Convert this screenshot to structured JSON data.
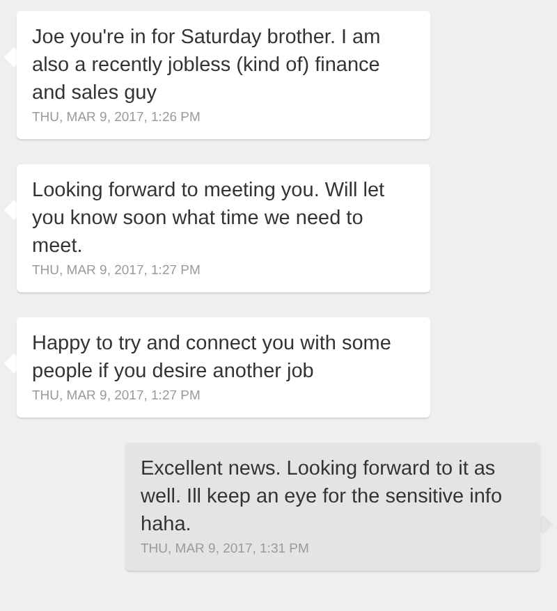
{
  "messages": [
    {
      "kind": "incoming",
      "text": "Joe you're in for Saturday brother. I am also a recently jobless (kind of) finance and sales guy",
      "time": "THU, MAR 9, 2017, 1:26 PM"
    },
    {
      "kind": "incoming",
      "text": "Looking forward to meeting you. Will let you know soon what time we need to meet.",
      "time": "THU, MAR 9, 2017, 1:27 PM"
    },
    {
      "kind": "incoming",
      "text": "Happy to try and connect you with some people if you desire another job",
      "time": "THU, MAR 9, 2017, 1:27 PM"
    },
    {
      "kind": "outgoing",
      "text": "Excellent news. Looking forward to it as well. Ill keep an eye for the sensitive info haha.",
      "time": "THU, MAR 9, 2017, 1:31 PM"
    }
  ]
}
